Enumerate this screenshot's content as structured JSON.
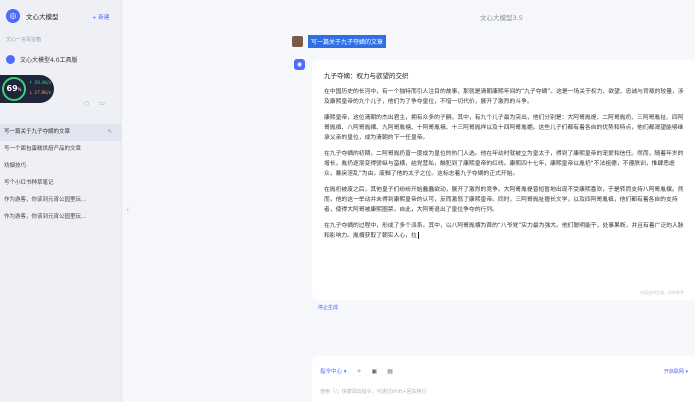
{
  "sidebar": {
    "brand": "文心大模型",
    "new_label": "+ 新建",
    "caption": "文心一言百宝箱",
    "model": "文心大模型4.0工具版",
    "speed": {
      "percent": "69",
      "unit": "%",
      "upload": "↑ 20.4K/s",
      "download": "↓ 27.8K/s"
    },
    "conversations": [
      {
        "title": "写一篇关于九子夺嫡的文章",
        "active": true
      },
      {
        "title": "写一个面包蛋糕烘焙产品的文章",
        "active": false
      },
      {
        "title": "劝烟技巧",
        "active": false
      },
      {
        "title": "写个小红书种草笔记",
        "active": false
      },
      {
        "title": "作为游客，你该到元宵公园里玩...",
        "active": false
      },
      {
        "title": "作为游客，你该到元宵公园里玩...",
        "active": false
      }
    ]
  },
  "header": {
    "title": "文心大模型3.5"
  },
  "user_message": "写一篇关于九子夺嫡的文章",
  "answer": {
    "title": "九子夺嫡：权力与欲望的交织",
    "paragraphs": [
      "在中国历史的长河中，有一个独特而引人注目的故事，那就是清朝康熙年间的“九子夺嫡”。这是一场关于权力、欲望、忠诚与背叛的较量，涉及康熙皇帝的九个儿子，他们为了争夺皇位，不惜一切代价，展开了激烈的斗争。",
      "康熙皇帝，这位清朝的杰出君主，拥有众多的子嗣。其中，有九个儿子最为突出，他们分别是：大阿哥胤禔、二阿哥胤礽、三阿哥胤祉、四阿哥胤禛、八阿哥胤禩、九阿哥胤禟、十阿哥胤䄉、十三阿哥胤祥以及十四阿哥胤禵。这些儿子们都有着各自的优势和特点，他们都渴望能够继承父亲的皇位，成为清朝的下一任皇帝。",
      "在九子夺嫡的初期，二阿哥胤礽曾一度成为皇位的热门人选。他在年幼时就被立为皇太子，得到了康熙皇帝的宠爱和信任。然而，随着年岁的增长，胤礽逐渐变得骄纵与蛮横，结党营私，触犯到了康熙皇帝的红线。康熙四十七年，康熙皇帝以胤礽“不法祖德，不遵朕训，惟肆恶虐众，暴戾淫乱”为由，废黜了他的太子之位。这标志着九子夺嫡的正式开始。",
      "在胤礽被废之后，其他皇子们纷纷开始蠢蠢欲动，展开了激烈的竞争。大阿哥胤禔曾短暂地出现不受康熙喜欢，于是转而支持八阿哥胤禩。然而，他的这一举动并未得到康熙皇帝的认可，反而激怒了康熙皇帝。同时，三阿哥胤祉擅长文学，以及四阿哥胤禛，他们都有着各自的支持者，使得大阿哥被康熙圈禁，自此，大阿哥退出了皇位争夺的行列。",
      "在九子夺嫡的过程中，形成了多个派系。其中，以八阿哥胤禩为首的“八爷党”实力最为强大。他们聪明能干，处事果断，并且有着广泛的人脉和影响力。胤禩获取了朝实人心，拉"
    ],
    "watermark": "内容由AI生成，仅供参考"
  },
  "stop_label": "停止生成",
  "input": {
    "mode_label": "指令中心 ▾",
    "right_option": "开启联网 ▾",
    "placeholder": "使用「/」快捷调出指令，可通过shift+回车换行"
  }
}
